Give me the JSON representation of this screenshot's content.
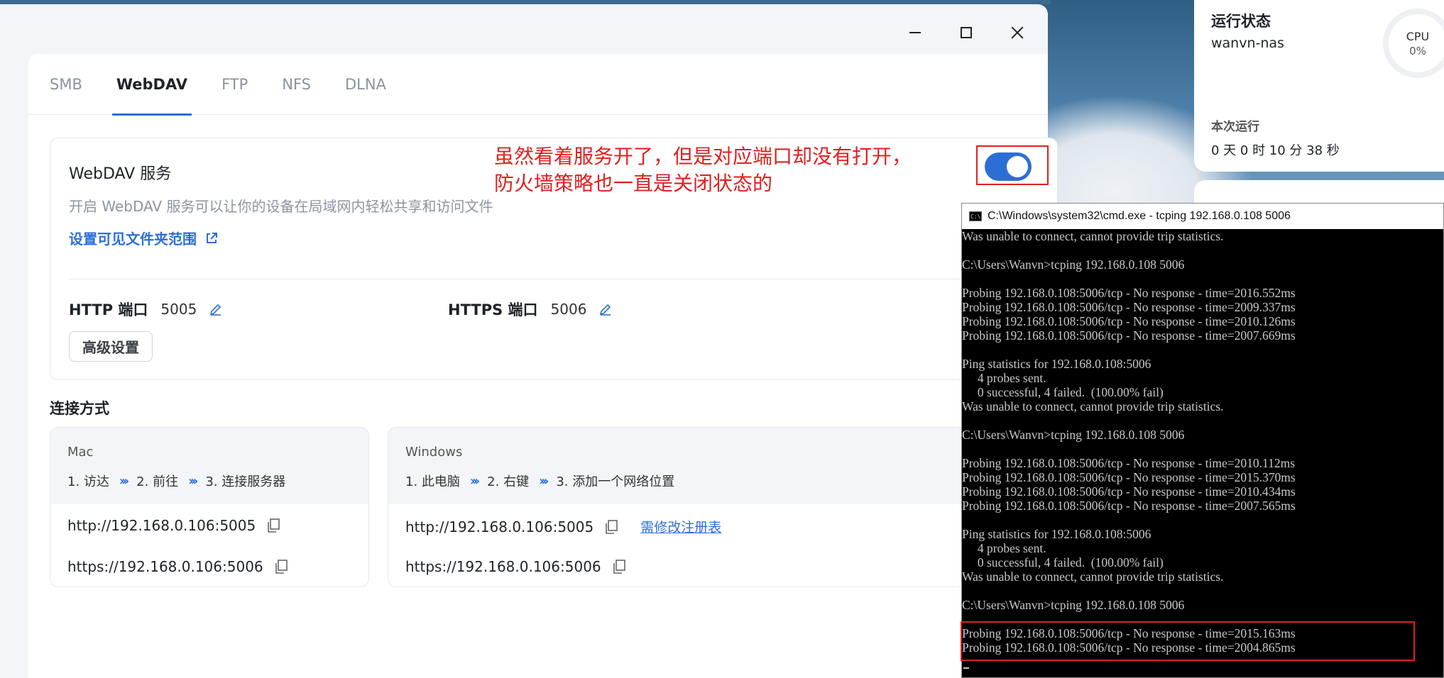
{
  "window": {
    "controls": {
      "minimize": "minimize",
      "maximize": "maximize",
      "close": "close"
    }
  },
  "tabs": [
    "SMB",
    "WebDAV",
    "FTP",
    "NFS",
    "DLNA"
  ],
  "active_tab": "WebDAV",
  "service": {
    "title": "WebDAV 服务",
    "description": "开启 WebDAV 服务可以让你的设备在局域网内轻松共享和访问文件",
    "folder_link": "设置可见文件夹范围",
    "http_label": "HTTP 端口",
    "http_port": "5005",
    "https_label": "HTTPS 端口",
    "https_port": "5006",
    "advanced_button": "高级设置",
    "enabled": true
  },
  "connection": {
    "title": "连接方式",
    "mac": {
      "os": "Mac",
      "steps": [
        "1. 访达",
        "2. 前往",
        "3. 连接服务器"
      ],
      "http_url": "http://192.168.0.106:5005",
      "https_url": "https://192.168.0.106:5006"
    },
    "windows": {
      "os": "Windows",
      "steps": [
        "1. 此电脑",
        "2. 右键",
        "3. 添加一个网络位置"
      ],
      "http_url": "http://192.168.0.106:5005",
      "https_url": "https://192.168.0.106:5006",
      "registry_link": "需修改注册表"
    }
  },
  "annotation": {
    "line1": "虽然看着服务开了，但是对应端口却没有打开，",
    "line2": "防火墙策略也一直是关闭状态的",
    "color": "#e02020"
  },
  "widget": {
    "title": "运行状态",
    "hostname": "wanvn-nas",
    "cpu_label": "CPU",
    "cpu_value": "0%",
    "run_label": "本次运行",
    "uptime": "0 天 0 时 10 分 38 秒"
  },
  "cmd": {
    "title": "C:\\Windows\\system32\\cmd.exe - tcping  192.168.0.108 5006",
    "lines": [
      "Was unable to connect, cannot provide trip statistics.",
      "",
      "C:\\Users\\Wanvn>tcping 192.168.0.108 5006",
      "",
      "Probing 192.168.0.108:5006/tcp - No response - time=2016.552ms",
      "Probing 192.168.0.108:5006/tcp - No response - time=2009.337ms",
      "Probing 192.168.0.108:5006/tcp - No response - time=2010.126ms",
      "Probing 192.168.0.108:5006/tcp - No response - time=2007.669ms",
      "",
      "Ping statistics for 192.168.0.108:5006",
      "     4 probes sent.",
      "     0 successful, 4 failed.  (100.00% fail)",
      "Was unable to connect, cannot provide trip statistics.",
      "",
      "C:\\Users\\Wanvn>tcping 192.168.0.108 5006",
      "",
      "Probing 192.168.0.108:5006/tcp - No response - time=2010.112ms",
      "Probing 192.168.0.108:5006/tcp - No response - time=2015.370ms",
      "Probing 192.168.0.108:5006/tcp - No response - time=2010.434ms",
      "Probing 192.168.0.108:5006/tcp - No response - time=2007.565ms",
      "",
      "Ping statistics for 192.168.0.108:5006",
      "     4 probes sent.",
      "     0 successful, 4 failed.  (100.00% fail)",
      "Was unable to connect, cannot provide trip statistics.",
      "",
      "C:\\Users\\Wanvn>tcping 192.168.0.108 5006",
      "",
      "Probing 192.168.0.108:5006/tcp - No response - time=2015.163ms",
      "Probing 192.168.0.108:5006/tcp - No response - time=2004.865ms"
    ]
  },
  "colors": {
    "accent": "#2b6fd6",
    "annotation_red": "#e02020"
  }
}
